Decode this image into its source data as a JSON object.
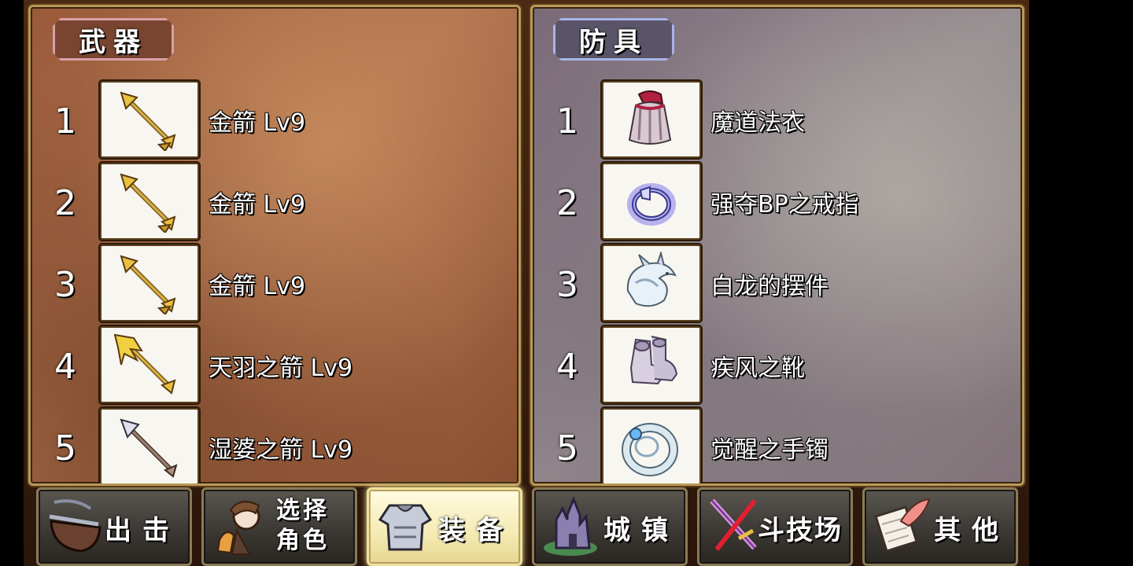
{
  "weapons": {
    "title": "武器",
    "items": [
      {
        "num": "1",
        "name": "金箭 Lv9",
        "icon": "golden-arrow-icon"
      },
      {
        "num": "2",
        "name": "金箭 Lv9",
        "icon": "golden-arrow-icon"
      },
      {
        "num": "3",
        "name": "金箭 Lv9",
        "icon": "golden-arrow-icon"
      },
      {
        "num": "4",
        "name": "天羽之箭 Lv9",
        "icon": "feather-arrow-icon"
      },
      {
        "num": "5",
        "name": "湿婆之箭 Lv9",
        "icon": "silver-arrow-icon"
      }
    ]
  },
  "armor": {
    "title": "防具",
    "items": [
      {
        "num": "1",
        "name": "魔道法衣",
        "icon": "robe-icon"
      },
      {
        "num": "2",
        "name": "强夺BP之戒指",
        "icon": "ring-icon"
      },
      {
        "num": "3",
        "name": "白龙的摆件",
        "icon": "white-dragon-icon"
      },
      {
        "num": "4",
        "name": "疾风之靴",
        "icon": "boots-icon"
      },
      {
        "num": "5",
        "name": "觉醒之手镯",
        "icon": "bracelet-icon"
      }
    ]
  },
  "nav": {
    "sortie": "出击",
    "select_line1": "选择",
    "select_line2": "角色",
    "equip": "装备",
    "town": "城镇",
    "arena": "斗技场",
    "other": "其他",
    "active": "equip"
  },
  "colors": {
    "weapon_panel": "#a86a48",
    "armor_panel": "#8a8088",
    "active_button": "#f4ebb4",
    "frame_gold": "#b89a5a"
  }
}
